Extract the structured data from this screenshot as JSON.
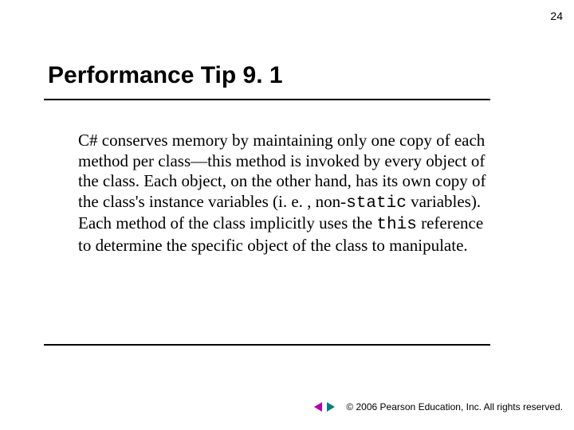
{
  "page_number": "24",
  "title": "Performance Tip 9. 1",
  "body": {
    "p1": "C# conserves memory by maintaining only one copy of each method per class—this method is invoked by every object of the class. Each object, on the other hand, has its own copy of the class's instance variables (i. e. , non-",
    "code1": "static",
    "p2": " variables). Each method of the class implicitly uses the ",
    "code2": "this",
    "p3": " reference to determine the specific object of the class to manipulate."
  },
  "footer": {
    "copyright": "© 2006 Pearson Education, Inc.  All rights reserved."
  },
  "colors": {
    "nav_prev": "#b400b4",
    "nav_next": "#008080"
  }
}
